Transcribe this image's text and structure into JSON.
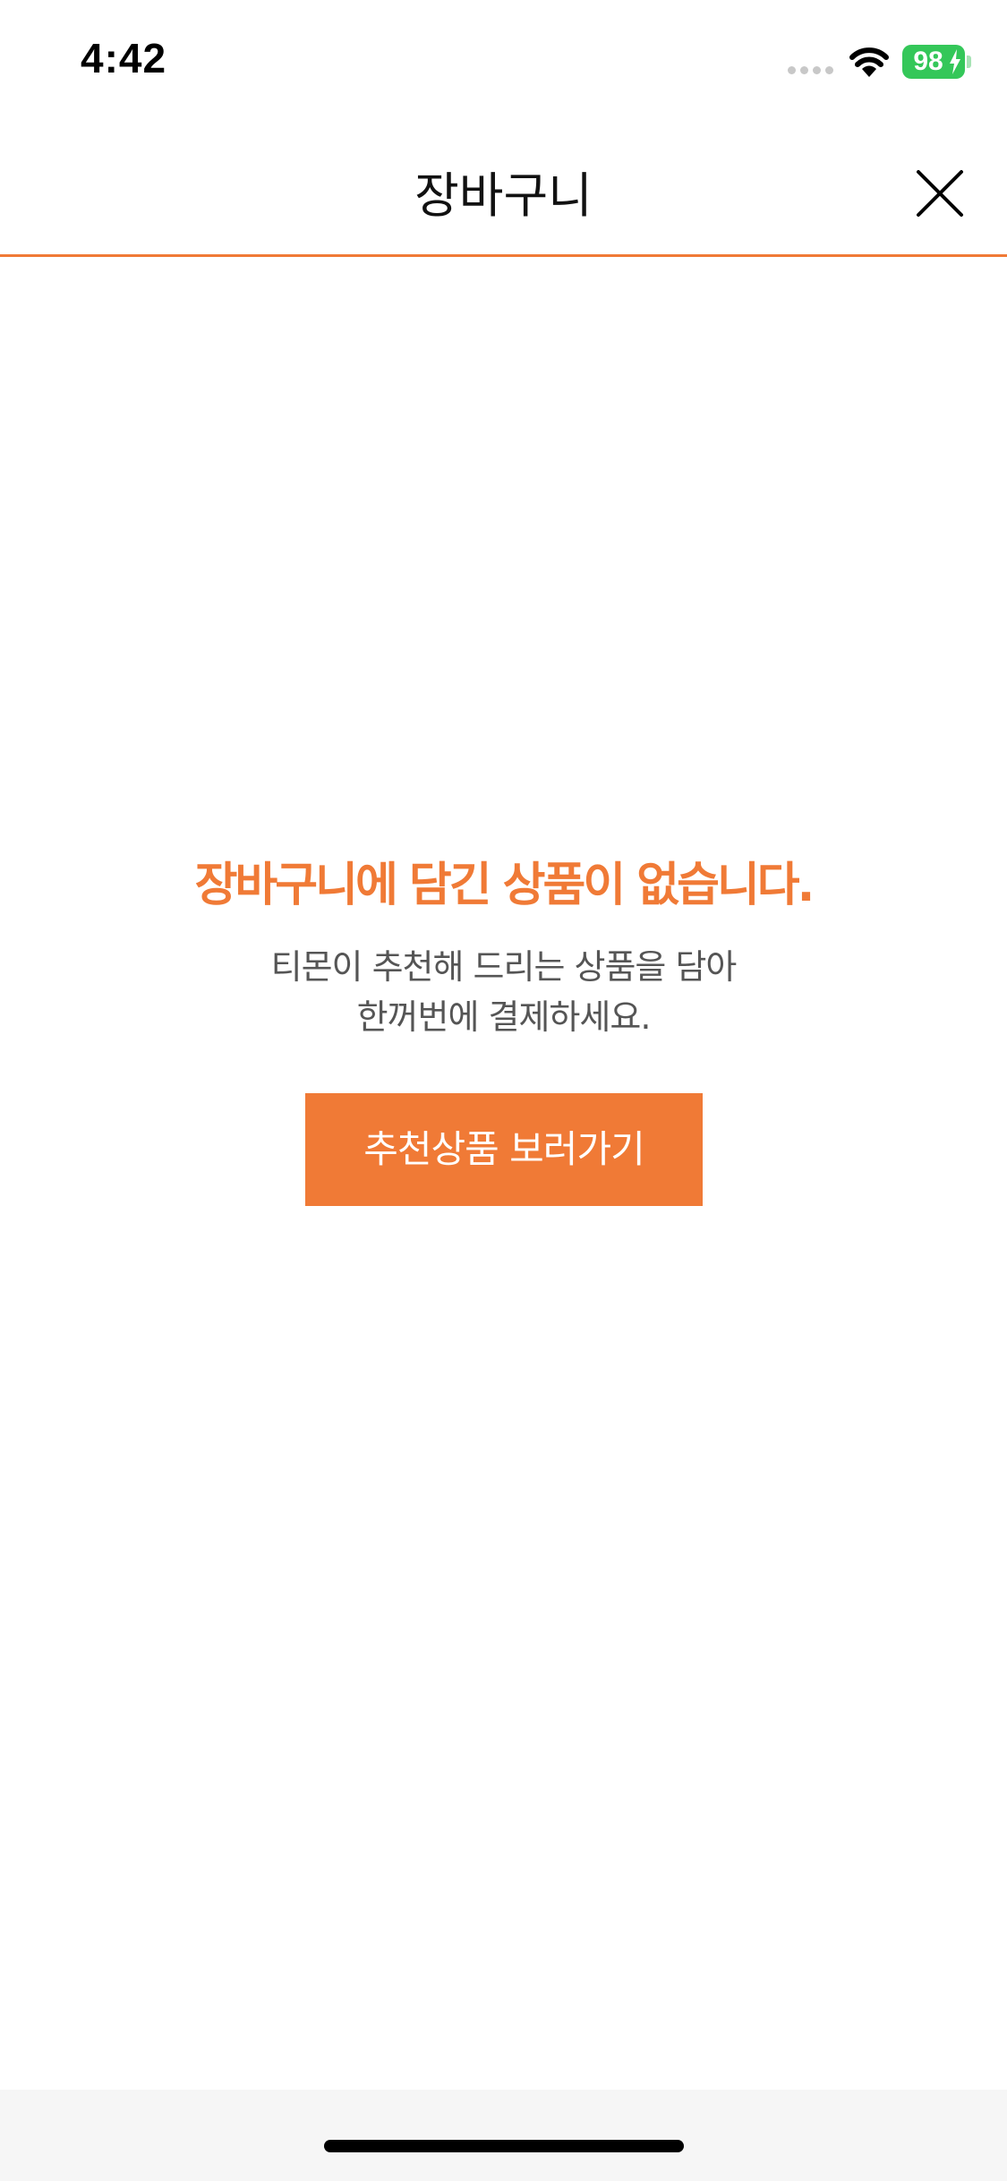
{
  "status_bar": {
    "time": "4:42",
    "battery_level": "98",
    "battery_color": "#34c759"
  },
  "header": {
    "title": "장바구니",
    "close_icon": "close-icon"
  },
  "empty_state": {
    "title": "장바구니에 담긴 상품이 없습니다.",
    "description_line1": "티몬이 추천해 드리는 상품을 담아",
    "description_line2": "한꺼번에 결제하세요.",
    "button_label": "추천상품 보러가기"
  },
  "colors": {
    "accent": "#f07a36",
    "background": "#ffffff"
  }
}
